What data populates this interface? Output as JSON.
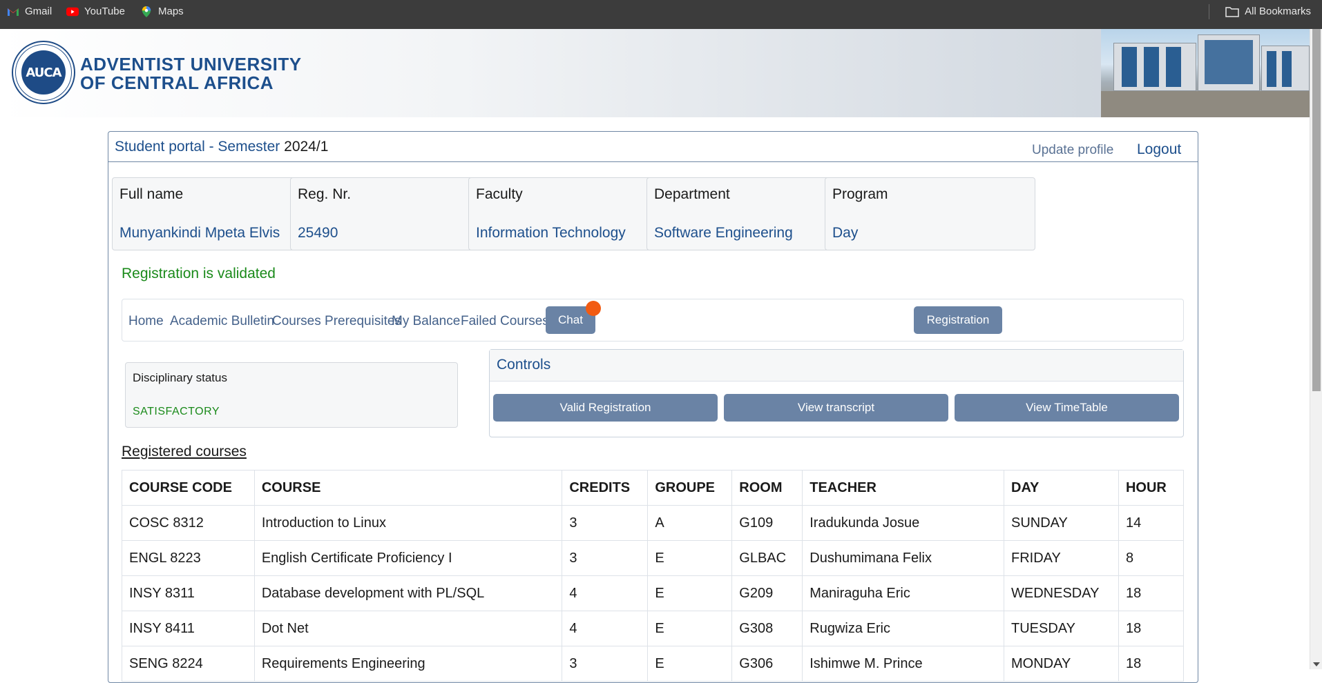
{
  "bookmarks": {
    "items": [
      {
        "label": "Gmail",
        "icon": "gmail-icon"
      },
      {
        "label": "YouTube",
        "icon": "youtube-icon"
      },
      {
        "label": "Maps",
        "icon": "maps-icon"
      }
    ],
    "all_label": "All Bookmarks"
  },
  "banner": {
    "logo_text": "AUCA",
    "name_line1": "ADVENTIST UNIVERSITY",
    "name_line2": "OF CENTRAL AFRICA"
  },
  "header": {
    "title": "Student portal - Semester",
    "semester": "2024/1",
    "update_profile": "Update profile",
    "logout": "Logout"
  },
  "info": [
    {
      "label": "Full name",
      "value": "Munyankindi Mpeta Elvis"
    },
    {
      "label": "Reg. Nr.",
      "value": "25490"
    },
    {
      "label": "Faculty",
      "value": "Information Technology"
    },
    {
      "label": "Department",
      "value": "Software Engineering"
    },
    {
      "label": "Program",
      "value": "Day"
    }
  ],
  "status": {
    "registration": "Registration is validated"
  },
  "nav": {
    "links": [
      "Home",
      "Academic Bulletin",
      "Courses Prerequisites",
      "My Balance",
      "Failed Courses"
    ],
    "chat": "Chat",
    "registration": "Registration"
  },
  "disciplinary": {
    "label": "Disciplinary status",
    "value": "SATISFACTORY"
  },
  "controls": {
    "title": "Controls",
    "buttons": [
      "Valid Registration",
      "View transcript",
      "View TimeTable"
    ]
  },
  "courses": {
    "title": "Registered courses",
    "columns": [
      "COURSE CODE",
      "COURSE",
      "CREDITS",
      "GROUPE",
      "ROOM",
      "TEACHER",
      "DAY",
      "HOUR"
    ],
    "rows": [
      [
        "COSC 8312",
        "Introduction to Linux",
        "3",
        "A",
        "G109",
        "Iradukunda Josue",
        "SUNDAY",
        "14"
      ],
      [
        "ENGL 8223",
        "English Certificate Proficiency I",
        "3",
        "E",
        "GLBAC",
        "Dushumimana Felix",
        "FRIDAY",
        "8"
      ],
      [
        "INSY 8311",
        "Database development with PL/SQL",
        "4",
        "E",
        "G209",
        "Maniraguha Eric",
        "WEDNESDAY",
        "18"
      ],
      [
        "INSY 8411",
        "Dot Net",
        "4",
        "E",
        "G308",
        "Rugwiza Eric",
        "TUESDAY",
        "18"
      ],
      [
        "SENG 8224",
        "Requirements Engineering",
        "3",
        "E",
        "G306",
        "Ishimwe M. Prince",
        "MONDAY",
        "18"
      ]
    ]
  },
  "colors": {
    "brand": "#1d4f8c",
    "button": "#6a83a5",
    "success": "#1a8a1a",
    "notification": "#f25b12"
  }
}
